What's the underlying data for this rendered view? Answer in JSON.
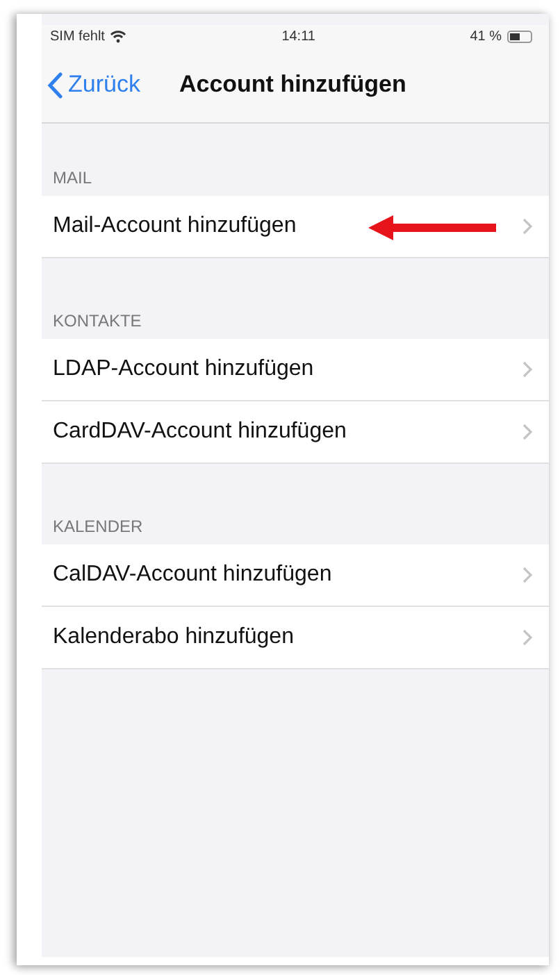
{
  "status_bar": {
    "carrier": "SIM fehlt",
    "time": "14:11",
    "battery": "41 %"
  },
  "nav": {
    "back": "Zurück",
    "title": "Account hinzufügen"
  },
  "sections": [
    {
      "header": "MAIL",
      "rows": [
        {
          "label": "Mail-Account hinzufügen",
          "highlighted": true
        }
      ]
    },
    {
      "header": "KONTAKTE",
      "rows": [
        {
          "label": "LDAP-Account hinzufügen",
          "highlighted": false
        },
        {
          "label": "CardDAV-Account hinzufügen",
          "highlighted": false
        }
      ]
    },
    {
      "header": "KALENDER",
      "rows": [
        {
          "label": "CalDAV-Account hinzufügen",
          "highlighted": false
        },
        {
          "label": "Kalenderabo hinzufügen",
          "highlighted": false
        }
      ]
    }
  ]
}
